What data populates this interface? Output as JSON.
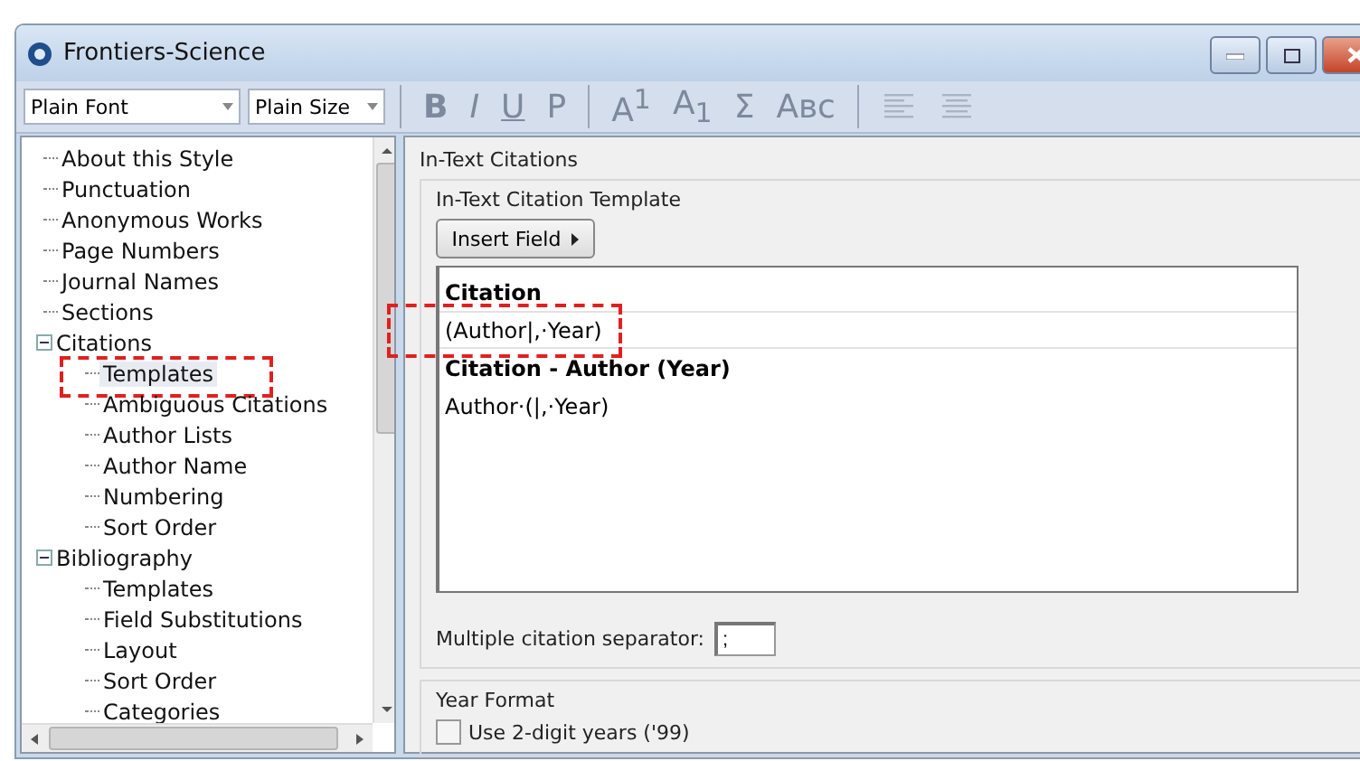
{
  "window": {
    "title": "Frontiers-Science"
  },
  "toolbar": {
    "font": "Plain Font",
    "size": "Plain Size",
    "disabled": true,
    "buttons": [
      {
        "kind": "text",
        "label": "B"
      },
      {
        "kind": "text",
        "label": "I"
      },
      {
        "kind": "text",
        "label": "U"
      },
      {
        "kind": "text",
        "label": "P"
      },
      {
        "kind": "separator"
      },
      {
        "kind": "text",
        "label": "A$^{1}$"
      },
      {
        "kind": "text",
        "label": "A$_{1}$"
      },
      {
        "kind": "text",
        "label": "Σ"
      },
      {
        "kind": "text",
        "label": "Aʙᴄ"
      },
      {
        "kind": "separator"
      },
      {
        "kind": "align-left"
      },
      {
        "kind": "align-center"
      }
    ]
  },
  "tree": [
    {
      "label": "About this Style",
      "selected": false,
      "highlighted": false
    },
    {
      "label": "Punctuation",
      "selected": false,
      "highlighted": false
    },
    {
      "label": "Anonymous Works",
      "selected": false,
      "highlighted": false
    },
    {
      "label": "Page Numbers",
      "selected": false,
      "highlighted": false
    },
    {
      "label": "Journal Names",
      "selected": false,
      "highlighted": false
    },
    {
      "label": "Sections",
      "selected": false,
      "highlighted": false
    },
    {
      "label": "Citations",
      "selected": false,
      "highlighted": false,
      "expanded": true,
      "children": [
        {
          "label": "Templates",
          "selected": true,
          "highlighted": true
        },
        {
          "label": "Ambiguous Citations",
          "selected": false,
          "highlighted": false
        },
        {
          "label": "Author Lists",
          "selected": false,
          "highlighted": false
        },
        {
          "label": "Author Name",
          "selected": false,
          "highlighted": false
        },
        {
          "label": "Numbering",
          "selected": false,
          "highlighted": false
        },
        {
          "label": "Sort Order",
          "selected": false,
          "highlighted": false
        }
      ]
    },
    {
      "label": "Bibliography",
      "selected": false,
      "highlighted": false,
      "expanded": true,
      "children": [
        {
          "label": "Templates",
          "selected": false,
          "highlighted": false
        },
        {
          "label": "Field Substitutions",
          "selected": false,
          "highlighted": false
        },
        {
          "label": "Layout",
          "selected": false,
          "highlighted": false
        },
        {
          "label": "Sort Order",
          "selected": false,
          "highlighted": false
        },
        {
          "label": "Categories",
          "selected": false,
          "highlighted": false
        }
      ]
    }
  ],
  "panel": {
    "group": "In-Text Citations",
    "template_group": "In-Text Citation Template",
    "insert_button": "Insert Field",
    "template_lines": [
      {
        "kind": "heading",
        "text": "Citation",
        "current": false,
        "highlighted": false
      },
      {
        "kind": "template",
        "text": "(Author|,·Year)",
        "current": true,
        "highlighted": true
      },
      {
        "kind": "heading",
        "text": "Citation - Author (Year)",
        "current": false,
        "highlighted": false
      },
      {
        "kind": "template",
        "text": "Author·(|,·Year)",
        "current": false,
        "highlighted": false
      }
    ],
    "separator_label": "Multiple citation separator:",
    "separator_value": ";",
    "year_group": "Year Format",
    "year_checkbox": {
      "label": "Use 2-digit years ('99)",
      "checked": false
    }
  }
}
